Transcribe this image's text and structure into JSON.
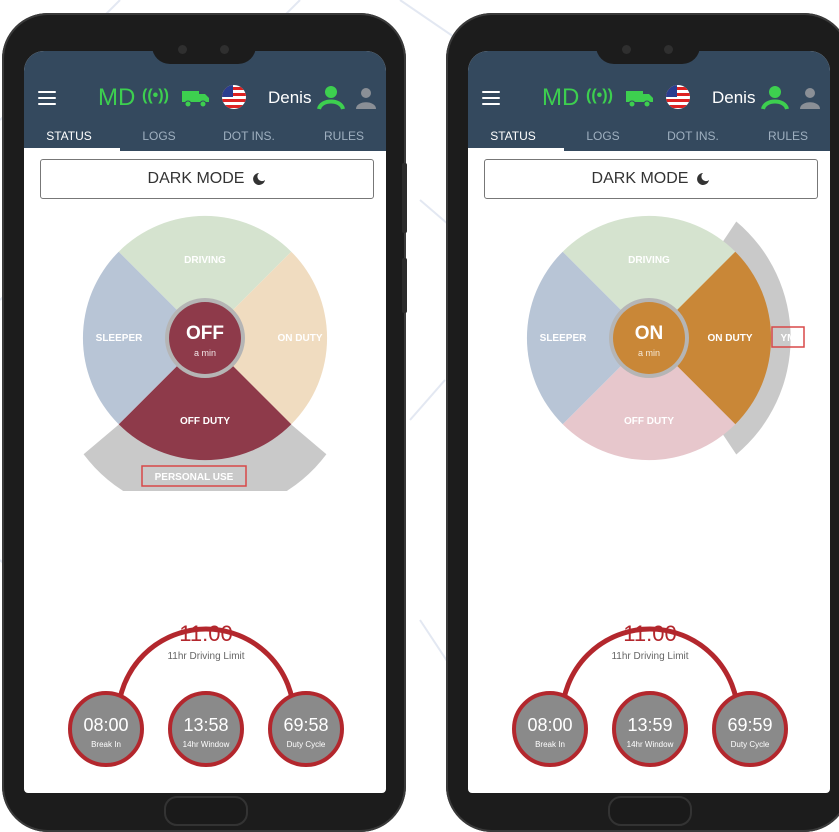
{
  "screens": [
    {
      "header": {
        "carrier_code": "MD",
        "user_name": "Denis"
      },
      "tabs": [
        {
          "label": "STATUS",
          "active": true
        },
        {
          "label": "LOGS",
          "active": false
        },
        {
          "label": "DOT INS.",
          "active": false
        },
        {
          "label": "RULES",
          "active": false
        }
      ],
      "dark_mode_label": "DARK MODE",
      "status_wheel": {
        "current_status": "OFF",
        "current_duration": "a min",
        "active_segment": "OFF DUTY",
        "segments": [
          "DRIVING",
          "ON DUTY",
          "OFF DUTY",
          "SLEEPER"
        ],
        "extension_label": "PERSONAL USE"
      },
      "timers": {
        "main": {
          "value": "11:00",
          "label": "11hr Driving Limit"
        },
        "break": {
          "value": "08:00",
          "label": "Break In"
        },
        "window": {
          "value": "13:58",
          "label": "14hr Window"
        },
        "cycle": {
          "value": "69:58",
          "label": "Duty Cycle"
        }
      }
    },
    {
      "header": {
        "carrier_code": "MD",
        "user_name": "Denis"
      },
      "tabs": [
        {
          "label": "STATUS",
          "active": true
        },
        {
          "label": "LOGS",
          "active": false
        },
        {
          "label": "DOT INS.",
          "active": false
        },
        {
          "label": "RULES",
          "active": false
        }
      ],
      "dark_mode_label": "DARK MODE",
      "status_wheel": {
        "current_status": "ON",
        "current_duration": "a min",
        "active_segment": "ON DUTY",
        "segments": [
          "DRIVING",
          "ON DUTY",
          "OFF DUTY",
          "SLEEPER"
        ],
        "extension_label": "YM"
      },
      "timers": {
        "main": {
          "value": "11:00",
          "label": "11hr Driving Limit"
        },
        "break": {
          "value": "08:00",
          "label": "Break In"
        },
        "window": {
          "value": "13:59",
          "label": "14hr Window"
        },
        "cycle": {
          "value": "69:59",
          "label": "Duty Cycle"
        }
      }
    }
  ],
  "colors": {
    "header_bg": "#34495e",
    "accent_green": "#3dcf4f",
    "off_duty": "#8e3a4a",
    "on_duty": "#c98737",
    "driving_faded": "#d5e3cf",
    "sleeper_faded": "#b8c5d6",
    "timer_ring": "#b3272d"
  }
}
